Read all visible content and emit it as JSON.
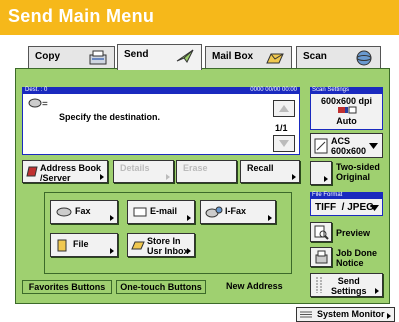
{
  "header": {
    "title": "Send Main Menu"
  },
  "tabs": [
    {
      "label": "Copy",
      "icon": "copy-icon",
      "active": false
    },
    {
      "label": "Send",
      "icon": "send-icon",
      "active": true
    },
    {
      "label": "Mail Box",
      "icon": "mailbox-icon",
      "active": false
    },
    {
      "label": "Scan",
      "icon": "scan-icon",
      "active": false
    }
  ],
  "destination": {
    "header_left": "Dest. :  0",
    "header_right": "0000 00/00 00:00",
    "prompt": "Specify the destination.",
    "page_indicator": "1/1"
  },
  "scan_settings": {
    "title": "Scan Settings",
    "resolution": "600x600 dpi",
    "color_mode": "Auto",
    "paper_size": "ACS\n600x600",
    "two_sided": "Two-sided\nOriginal"
  },
  "toolbar": {
    "address_book": "Address Book\n/Server",
    "details": "Details",
    "erase": "Erase",
    "recall": "Recall"
  },
  "send_types": {
    "fax": "Fax",
    "email": "E-mail",
    "ifax": "I-Fax",
    "file": "File",
    "store_inbox": "Store In\nUsr Inbox"
  },
  "bottom_tabs": {
    "favorites": "Favorites Buttons",
    "one_touch": "One-touch Buttons",
    "new_address": "New Address"
  },
  "file_format": {
    "title": "File Format",
    "value": "TIFF  / JPEG"
  },
  "right_buttons": {
    "preview": "Preview",
    "job_done": "Job Done\nNotice",
    "send_settings": "Send\nSettings"
  },
  "status": {
    "system_monitor": "System Monitor"
  },
  "colors": {
    "header": "#f6b81a",
    "panel": "#9fd070",
    "accent_blue": "#1a2abf"
  }
}
